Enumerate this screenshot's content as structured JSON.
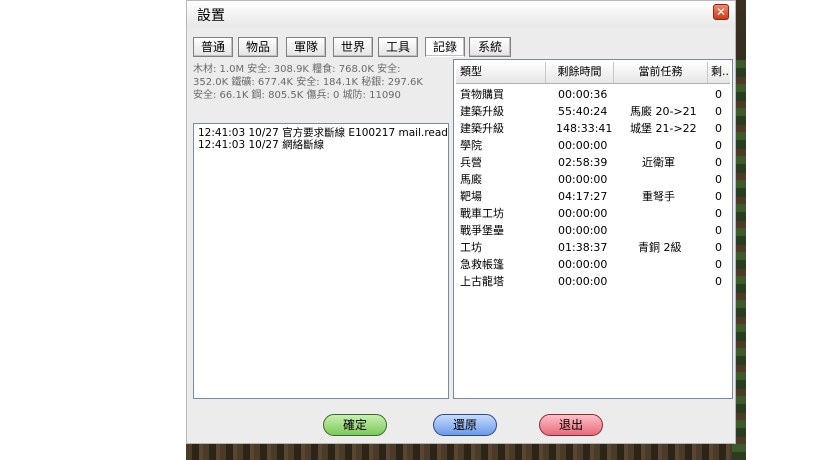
{
  "window": {
    "title": "設置",
    "close_label": "✕"
  },
  "tabs": [
    {
      "label": "普通"
    },
    {
      "label": "物品"
    },
    {
      "label": "軍隊"
    },
    {
      "label": "世界"
    },
    {
      "label": "工具"
    },
    {
      "label": "記錄",
      "active": true
    },
    {
      "label": "系統"
    }
  ],
  "resources": {
    "line1": "木材: 1.0M 安全: 308.9K  糧食: 768.0K 安全:",
    "line2": "352.0K  鐵礦: 677.4K 安全: 184.1K  秘銀: 297.6K",
    "line3": "安全: 66.1K  鋼: 805.5K  傷兵: 0  城防: 11090"
  },
  "log": [
    "12:41:03 10/27  官方要求斷線 E100217 mail.read",
    "12:41:03 10/27  網絡斷線"
  ],
  "table": {
    "headers": [
      "類型",
      "剩餘時間",
      "當前任務",
      "剩.."
    ],
    "rows": [
      {
        "type": "貨物購買",
        "time": "00:00:36",
        "task": "",
        "count": "0"
      },
      {
        "type": "建築升級",
        "time": "55:40:24",
        "task": "馬廄 20->21",
        "count": "0"
      },
      {
        "type": "建築升級",
        "time": "148:33:41",
        "task": "城堡 21->22",
        "count": "0"
      },
      {
        "type": "學院",
        "time": "00:00:00",
        "task": "",
        "count": "0"
      },
      {
        "type": "兵營",
        "time": "02:58:39",
        "task": "近衛軍",
        "count": "0"
      },
      {
        "type": "馬廄",
        "time": "00:00:00",
        "task": "",
        "count": "0"
      },
      {
        "type": "靶場",
        "time": "04:17:27",
        "task": "重弩手",
        "count": "0"
      },
      {
        "type": "戰車工坊",
        "time": "00:00:00",
        "task": "",
        "count": "0"
      },
      {
        "type": "戰爭堡壘",
        "time": "00:00:00",
        "task": "",
        "count": "0"
      },
      {
        "type": "工坊",
        "time": "01:38:37",
        "task": "青銅 2級",
        "count": "0"
      },
      {
        "type": "急救帳篷",
        "time": "00:00:00",
        "task": "",
        "count": "0"
      },
      {
        "type": "上古龍塔",
        "time": "00:00:00",
        "task": "",
        "count": "0"
      }
    ]
  },
  "buttons": {
    "ok": "確定",
    "reset": "還原",
    "exit": "退出"
  }
}
